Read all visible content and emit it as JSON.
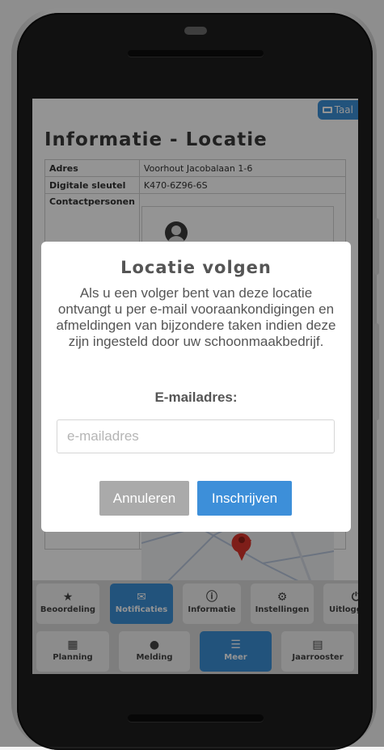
{
  "header": {
    "language_button": "Taal"
  },
  "page": {
    "title": "Informatie - Locatie",
    "table": [
      {
        "label": "Adres",
        "value": "Voorhout Jacobalaan 1-6"
      },
      {
        "label": "Digitale sleutel",
        "value": "K470-6Z96-6S"
      },
      {
        "label": "Contactpersonen",
        "value": ""
      }
    ]
  },
  "nav": {
    "row1": [
      {
        "label": "Beoordeling",
        "icon": "star-icon",
        "active": false
      },
      {
        "label": "Notificaties",
        "icon": "envelope-icon",
        "active": true
      },
      {
        "label": "Informatie",
        "icon": "info-icon",
        "active": false
      },
      {
        "label": "Instellingen",
        "icon": "gear-icon",
        "active": false
      },
      {
        "label": "Uitlogg",
        "icon": "power-icon",
        "active": false
      }
    ],
    "row2": [
      {
        "label": "Planning",
        "icon": "calendar-icon",
        "active": false
      },
      {
        "label": "Melding",
        "icon": "chat-icon",
        "active": false
      },
      {
        "label": "Meer",
        "icon": "menu-icon",
        "active": true
      },
      {
        "label": "Jaarrooster",
        "icon": "file-icon",
        "active": false
      }
    ]
  },
  "modal": {
    "title": "Locatie volgen",
    "text": "Als u een volger bent van deze locatie ontvangt u per e-mail vooraankondigingen en afmeldingen van bijzondere taken indien deze zijn ingesteld door uw schoonmaakbedrijf.",
    "email_label": "E-mailadres:",
    "email_placeholder": "e-mailadres",
    "email_value": "",
    "cancel_label": "Annuleren",
    "submit_label": "Inschrijven"
  },
  "colors": {
    "accent": "#3b8fd6",
    "cancel": "#aaaaaa",
    "map_pin": "#d9352b"
  }
}
